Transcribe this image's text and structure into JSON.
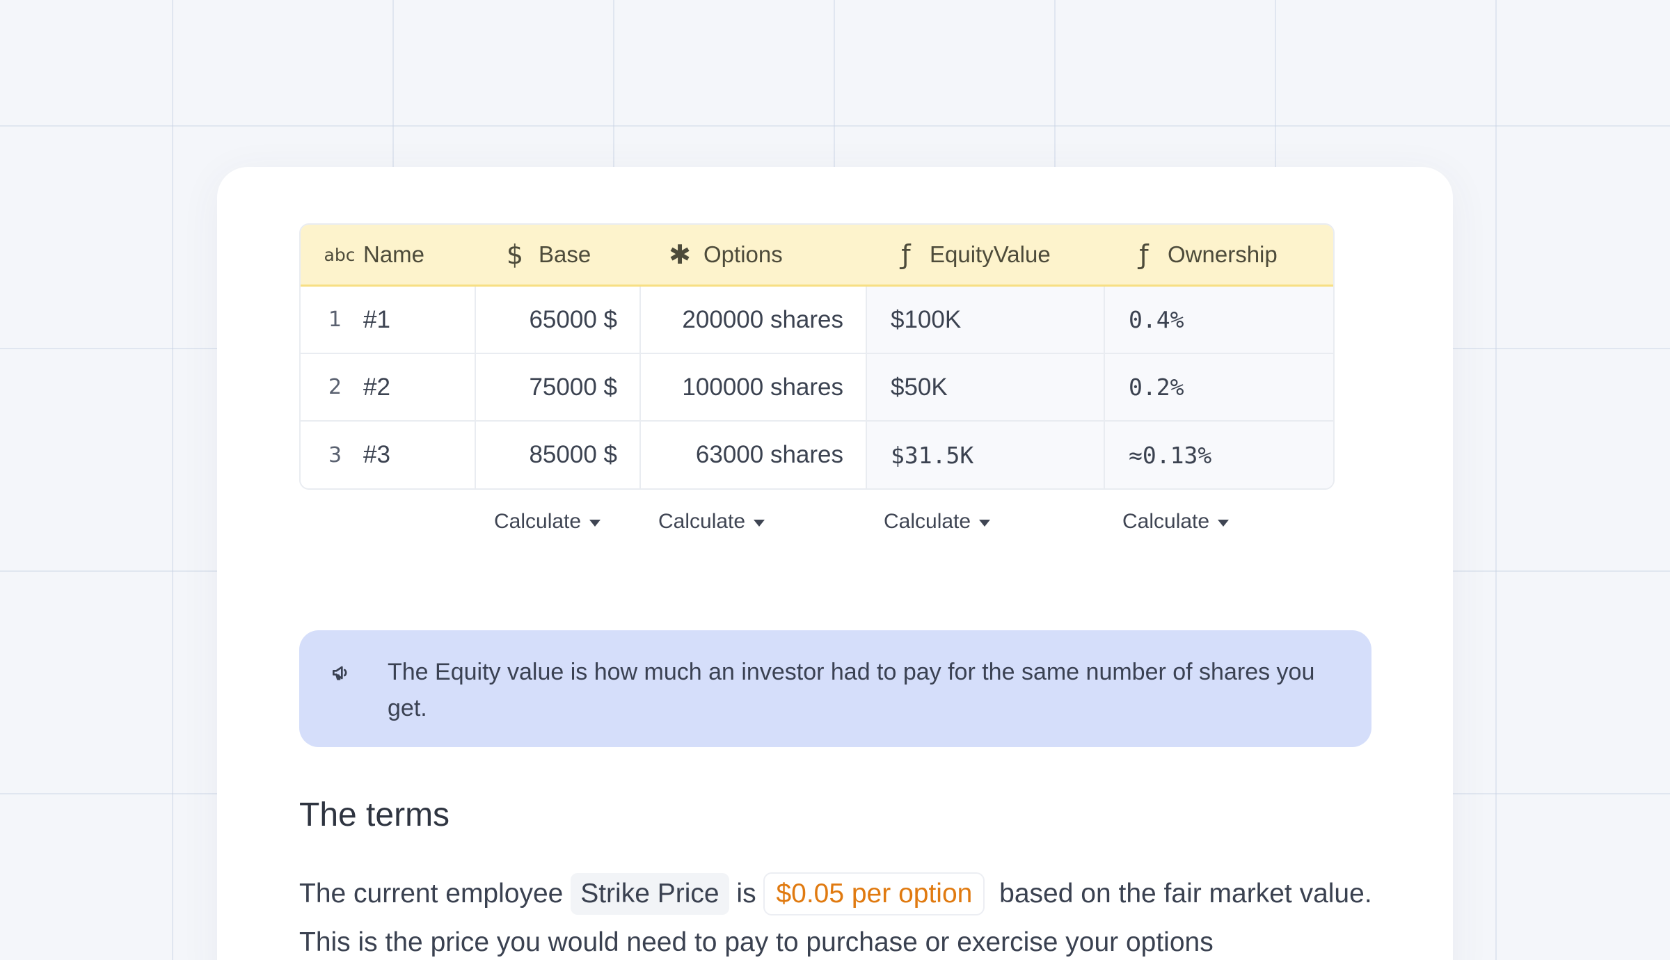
{
  "table": {
    "headers": [
      {
        "icon": "abc-text-icon",
        "glyph": "abc",
        "label": "Name"
      },
      {
        "icon": "dollar-icon",
        "glyph": "$",
        "label": "Base"
      },
      {
        "icon": "asterisk-icon",
        "glyph": "✱",
        "label": "Options"
      },
      {
        "icon": "function-icon",
        "glyph": "ƒ",
        "label": "EquityValue"
      },
      {
        "icon": "function-icon",
        "glyph": "ƒ",
        "label": "Ownership"
      }
    ],
    "rows": [
      {
        "index": "1",
        "name": "#1",
        "base": "65000 $",
        "options": "200000 shares",
        "equity": "$100K",
        "ownership": "0.4%"
      },
      {
        "index": "2",
        "name": "#2",
        "base": "75000 $",
        "options": "100000 shares",
        "equity": "$50K",
        "ownership": "0.2%"
      },
      {
        "index": "3",
        "name": "#3",
        "base": "85000 $",
        "options": "63000 shares",
        "equity": "$31.5K",
        "ownership": "≈0.13%"
      }
    ],
    "calculate_label": "Calculate"
  },
  "callout": {
    "icon": "megaphone-icon",
    "text": "The Equity value is how much an investor had to pay for the same number of shares you get."
  },
  "terms": {
    "title": "The terms",
    "para_before": "The current employee ",
    "strike_label": "Strike Price",
    "para_is": " is ",
    "strike_value": "$0.05 per option",
    "para_after": " based on the fair market value. This is the price you would need to pay to purchase or exercise your options"
  },
  "colors": {
    "header_bg": "#fdf3cc",
    "callout_bg": "#d5defa",
    "strike_value_color": "#e07a10"
  }
}
